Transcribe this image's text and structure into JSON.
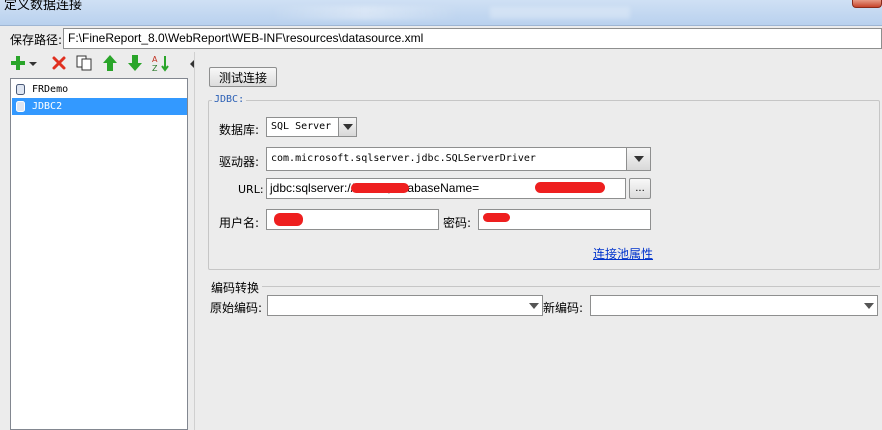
{
  "window": {
    "title": "定义数据连接"
  },
  "save_path": {
    "label": "保存路径:",
    "value": "F:\\FineReport_8.0\\WebReport\\WEB-INF\\resources\\datasource.xml"
  },
  "toolbar": {
    "icons": [
      "add-icon",
      "delete-icon",
      "copy-icon",
      "move-up-icon",
      "move-down-icon",
      "sort-icon"
    ]
  },
  "connections": [
    {
      "name": "FRDemo",
      "selected": false
    },
    {
      "name": "JDBC2",
      "selected": true
    }
  ],
  "test_button": "测试连接",
  "jdbc": {
    "legend": "JDBC:",
    "database_label": "数据库:",
    "database_value": "SQL Server",
    "driver_label": "驱动器:",
    "driver_value": "com.microsoft.sqlserver.jdbc.SQLServerDriver",
    "url_label": "URL:",
    "url_value": "jdbc:sqlserver://           :1433;databaseName=",
    "browse_label": "...",
    "username_label": "用户名:",
    "password_label": "密码:",
    "pool_link": "连接池属性"
  },
  "encoding": {
    "legend": "编码转换",
    "original_label": "原始编码:",
    "new_label": "新编码:"
  },
  "colors": {
    "selection": "#3399ff",
    "link": "#0033cc",
    "redaction": "#ee1f1f",
    "jdbc_legend": "#2a5fb5"
  }
}
